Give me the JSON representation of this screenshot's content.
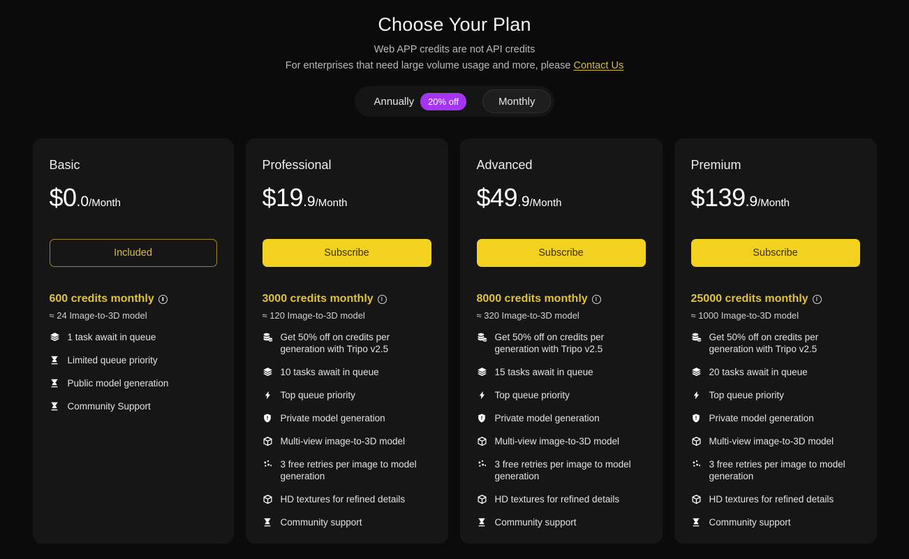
{
  "header": {
    "title": "Choose Your Plan",
    "subtitle_1": "Web APP credits are not API credits",
    "subtitle_2_prefix": "For enterprises that need large volume usage and more, please ",
    "contact_link": "Contact Us"
  },
  "billing_toggle": {
    "annually_label": "Annually",
    "annually_badge": "20% off",
    "monthly_label": "Monthly",
    "selected": "Monthly"
  },
  "colors": {
    "page_bg": "#0b0b0b",
    "card_bg": "#161616",
    "accent_yellow": "#f2d21e",
    "credits_yellow": "#e0c23c",
    "badge_purple": "#a435f0",
    "link_gold": "#d9bc3e"
  },
  "plans": [
    {
      "name": "Basic",
      "price_main": "$0",
      "price_dec": ".0",
      "price_per": "/Month",
      "cta_label": "Included",
      "cta_style": "outline",
      "credits": "600 credits monthly",
      "approx": "≈ 24 Image-to-3D model",
      "features": [
        {
          "icon": "layers-icon",
          "text": "1 task await in queue"
        },
        {
          "icon": "hourglass-icon",
          "text": "Limited queue priority"
        },
        {
          "icon": "hourglass-icon",
          "text": "Public model generation"
        },
        {
          "icon": "hourglass-icon",
          "text": "Community Support"
        }
      ]
    },
    {
      "name": "Professional",
      "price_main": "$19",
      "price_dec": ".9",
      "price_per": "/Month",
      "cta_label": "Subscribe",
      "cta_style": "solid",
      "credits": "3000 credits monthly",
      "approx": "≈ 120 Image-to-3D model",
      "features": [
        {
          "icon": "coins-icon",
          "text": "Get 50% off on credits per generation with Tripo v2.5"
        },
        {
          "icon": "layers-icon",
          "text": "10 tasks await in queue"
        },
        {
          "icon": "lightning-icon",
          "text": "Top queue priority"
        },
        {
          "icon": "shield-icon",
          "text": "Private model generation"
        },
        {
          "icon": "cube-icon",
          "text": "Multi-view image-to-3D model"
        },
        {
          "icon": "retry-icon",
          "text": "3 free retries per image to model generation"
        },
        {
          "icon": "cube-icon",
          "text": "HD textures for refined details"
        },
        {
          "icon": "hourglass-icon",
          "text": "Community support"
        }
      ]
    },
    {
      "name": "Advanced",
      "price_main": "$49",
      "price_dec": ".9",
      "price_per": "/Month",
      "cta_label": "Subscribe",
      "cta_style": "solid",
      "credits": "8000 credits monthly",
      "approx": "≈ 320 Image-to-3D model",
      "features": [
        {
          "icon": "coins-icon",
          "text": "Get 50% off on credits per generation with Tripo v2.5"
        },
        {
          "icon": "layers-icon",
          "text": "15 tasks await in queue"
        },
        {
          "icon": "lightning-icon",
          "text": "Top queue priority"
        },
        {
          "icon": "shield-icon",
          "text": "Private model generation"
        },
        {
          "icon": "cube-icon",
          "text": "Multi-view image-to-3D model"
        },
        {
          "icon": "retry-icon",
          "text": "3 free retries per image to model generation"
        },
        {
          "icon": "cube-icon",
          "text": "HD textures for refined details"
        },
        {
          "icon": "hourglass-icon",
          "text": "Community support"
        }
      ]
    },
    {
      "name": "Premium",
      "price_main": "$139",
      "price_dec": ".9",
      "price_per": "/Month",
      "cta_label": "Subscribe",
      "cta_style": "solid",
      "credits": "25000 credits monthly",
      "approx": "≈ 1000 Image-to-3D model",
      "features": [
        {
          "icon": "coins-icon",
          "text": "Get 50% off on credits per generation with Tripo v2.5"
        },
        {
          "icon": "layers-icon",
          "text": "20 tasks await in queue"
        },
        {
          "icon": "lightning-icon",
          "text": "Top queue priority"
        },
        {
          "icon": "shield-icon",
          "text": "Private model generation"
        },
        {
          "icon": "cube-icon",
          "text": "Multi-view image-to-3D model"
        },
        {
          "icon": "retry-icon",
          "text": "3 free retries per image to model generation"
        },
        {
          "icon": "cube-icon",
          "text": "HD textures for refined details"
        },
        {
          "icon": "hourglass-icon",
          "text": "Community support"
        }
      ]
    }
  ]
}
